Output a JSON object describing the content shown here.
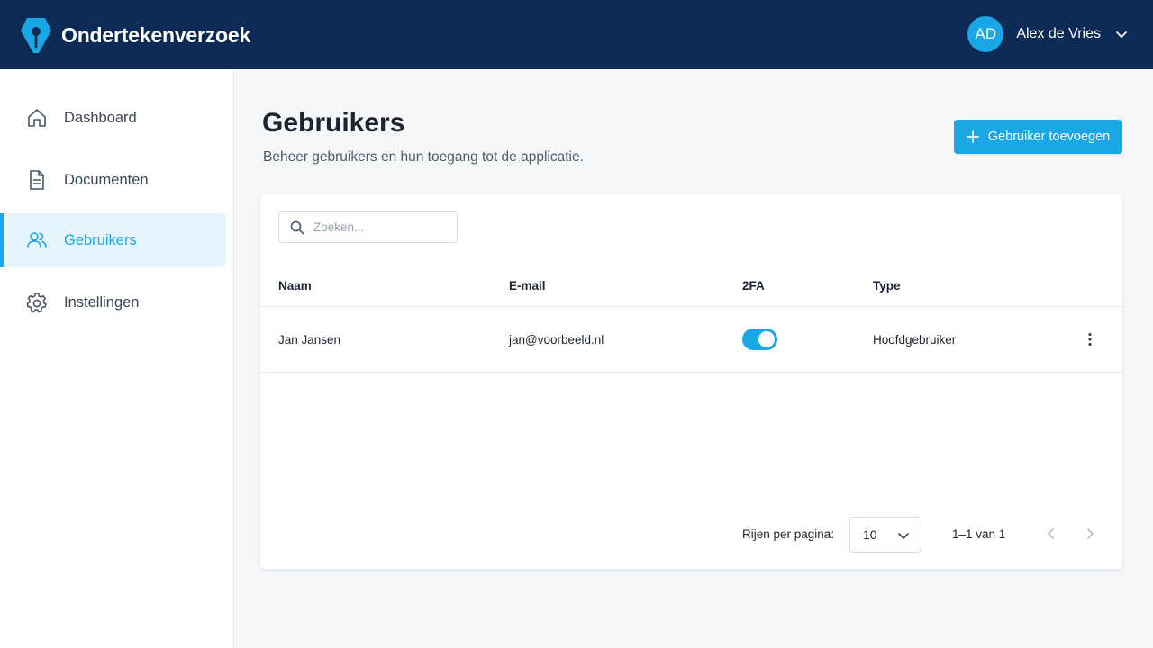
{
  "header": {
    "app_name": "Ondertekenverzoek",
    "user": {
      "initials": "AD",
      "name": "Alex de Vries"
    }
  },
  "sidebar": {
    "items": [
      {
        "label": "Dashboard",
        "icon": "home-icon",
        "active": false
      },
      {
        "label": "Documenten",
        "icon": "document-icon",
        "active": false
      },
      {
        "label": "Gebruikers",
        "icon": "users-icon",
        "active": true
      },
      {
        "label": "Instellingen",
        "icon": "gear-icon",
        "active": false
      }
    ]
  },
  "page": {
    "title": "Gebruikers",
    "subtitle": "Beheer gebruikers en hun toegang tot de applicatie.",
    "add_button_label": "Gebruiker toevoegen"
  },
  "search": {
    "placeholder": "Zoeken...",
    "value": ""
  },
  "table": {
    "columns": [
      "Naam",
      "E-mail",
      "2FA",
      "Type"
    ],
    "rows": [
      {
        "name": "Jan Jansen",
        "email": "jan@voorbeeld.nl",
        "twofa_enabled": true,
        "type": "Hoofdgebruiker"
      }
    ]
  },
  "pagination": {
    "rows_label": "Rijen per pagina:",
    "rows_per_page": "10",
    "range_text": "1–1 van 1"
  },
  "colors": {
    "header_bg": "#0b2a55",
    "accent": "#1aa7e6",
    "active_nav_bg": "#e6f5fc"
  }
}
